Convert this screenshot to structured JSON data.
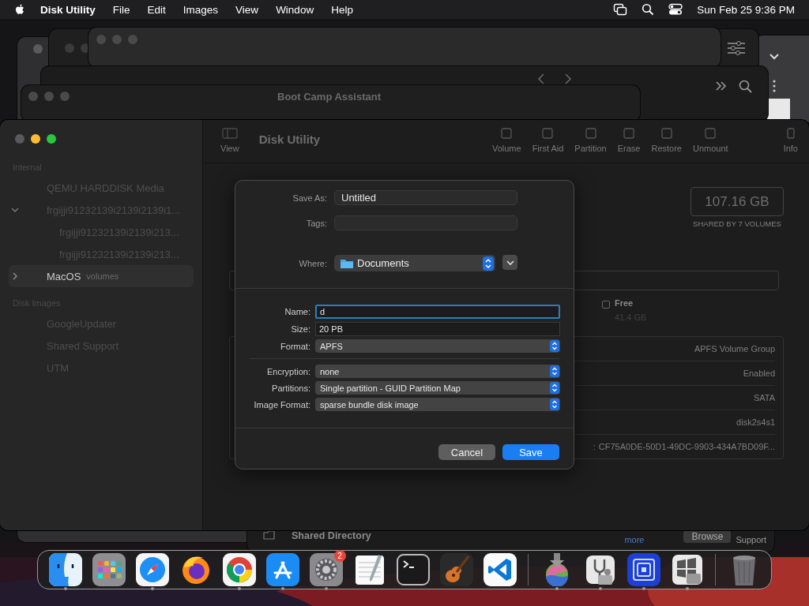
{
  "menu_bar": {
    "menus": [
      {
        "kind": "app",
        "label": "Disk Utility"
      },
      {
        "kind": "menu",
        "label": "File"
      },
      {
        "kind": "menu",
        "label": "Edit"
      },
      {
        "kind": "menu",
        "label": "Images"
      },
      {
        "kind": "menu",
        "label": "View"
      },
      {
        "kind": "menu",
        "label": "Window"
      },
      {
        "kind": "menu",
        "label": "Help"
      }
    ],
    "clock": "Sun Feb 25  9:36 PM"
  },
  "background_windows": [
    {
      "kind": "plain"
    },
    {
      "kind": "browser"
    },
    {
      "kind": "settings"
    },
    {
      "kind": "blank"
    },
    {
      "kind": "finder"
    },
    {
      "kind": "titled",
      "title": "Boot Camp Assistant"
    },
    {
      "kind": "utm",
      "label": "Shared Directory",
      "button": "Browse",
      "link": "more",
      "help": "Support"
    }
  ],
  "disk_utility": {
    "title": "Disk Utility",
    "view_label": "View",
    "actions": [
      "Volume",
      "First Aid",
      "Partition",
      "Erase",
      "Restore",
      "Unmount"
    ],
    "info_label": "Info",
    "sidebar": [
      {
        "title": "Internal",
        "items": [
          {
            "label": "QEMU HARDDISK Media",
            "selected": false
          },
          {
            "label": "frgijji91232139i2139i2139i1...",
            "selected": false,
            "expanded": true,
            "children": [
              {
                "label": "frgijji91232139i2139i213...",
                "selected": false
              },
              {
                "label": "frgijji91232139i2139i213...",
                "selected": false
              }
            ]
          },
          {
            "label": "MacOS",
            "sublabel": "volumes",
            "selected": true,
            "expanded": false
          }
        ]
      },
      {
        "title": "Disk Images",
        "items": [
          {
            "label": "GoogleUpdater",
            "selected": false
          },
          {
            "label": "Shared Support",
            "selected": false
          },
          {
            "label": "UTM",
            "selected": false
          }
        ]
      }
    ],
    "capacity": {
      "value": "107.16 GB",
      "caption": "SHARED BY 7 VOLUMES"
    },
    "legend": [
      {
        "label": "Free",
        "value": "41.4 GB"
      }
    ],
    "details": [
      {
        "value": "APFS Volume Group"
      },
      {
        "value": "Enabled"
      },
      {
        "value": "SATA"
      },
      {
        "value": "disk2s4s1"
      },
      {
        "label": ":",
        "value": "CF75A0DE-50D1-49DC-9903-434A7BD09F..."
      }
    ]
  },
  "save_sheet": {
    "save_as": {
      "label": "Save As:",
      "value": "Untitled"
    },
    "tags": {
      "label": "Tags:"
    },
    "where": {
      "label": "Where:",
      "value": "Documents"
    },
    "volume_fields": [
      {
        "kind": "text",
        "label": "Name:",
        "value": "d",
        "focused": true
      },
      {
        "kind": "text",
        "label": "Size:",
        "value": "20 PB",
        "focused": false
      },
      {
        "kind": "popup",
        "label": "Format:",
        "value": "APFS"
      }
    ],
    "image_fields": [
      {
        "kind": "popup",
        "label": "Encryption:",
        "value": "none"
      },
      {
        "kind": "popup",
        "label": "Partitions:",
        "value": "Single partition - GUID Partition Map"
      },
      {
        "kind": "popup",
        "label": "Image Format:",
        "value": "sparse bundle disk image"
      }
    ],
    "buttons": [
      {
        "kind": "secondary",
        "label": "Cancel"
      },
      {
        "kind": "default",
        "label": "Save"
      }
    ]
  },
  "dock": {
    "items": [
      {
        "kind": "finder",
        "running": true
      },
      {
        "kind": "launchpad",
        "running": false
      },
      {
        "kind": "safari",
        "running": true
      },
      {
        "kind": "firefox",
        "running": false
      },
      {
        "kind": "chrome",
        "running": true
      },
      {
        "kind": "appstore",
        "running": true
      },
      {
        "kind": "settings",
        "running": true,
        "badge": "2"
      },
      {
        "kind": "textedit",
        "running": false
      },
      {
        "kind": "terminal",
        "running": false
      },
      {
        "kind": "guitar",
        "running": false
      },
      {
        "kind": "code",
        "running": false
      },
      {
        "kind": "separator"
      },
      {
        "kind": "installer",
        "running": true
      },
      {
        "kind": "diskutility",
        "running": true
      },
      {
        "kind": "squares",
        "running": true
      },
      {
        "kind": "bootcamp",
        "running": true
      },
      {
        "kind": "separator"
      },
      {
        "kind": "trash",
        "running": false
      }
    ]
  }
}
